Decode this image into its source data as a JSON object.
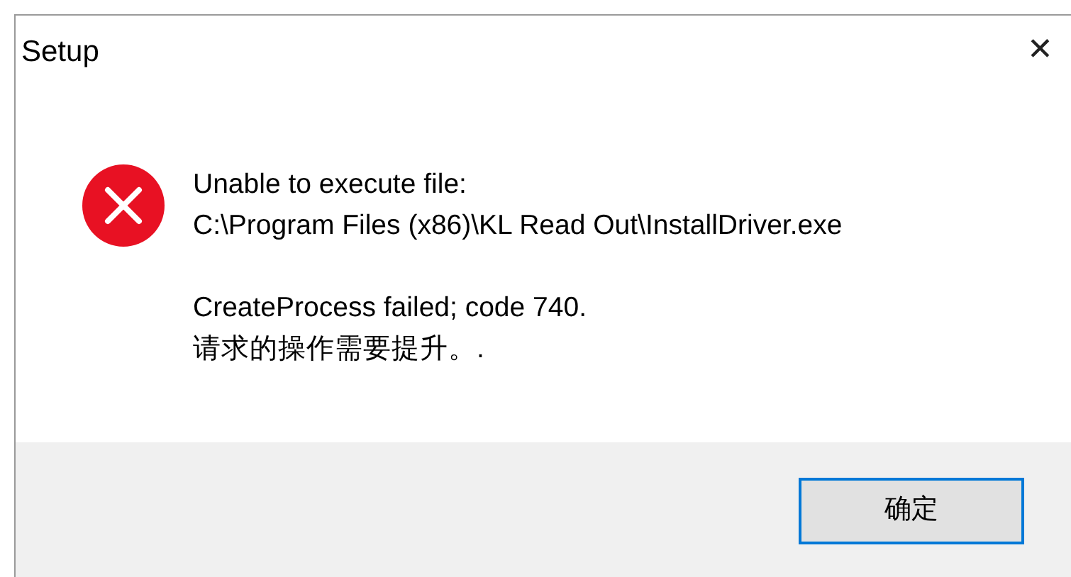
{
  "window": {
    "title": "Setup",
    "close": "✕"
  },
  "message": {
    "kind": "error",
    "paragraphs": [
      [
        "Unable to execute file:",
        "C:\\Program Files (x86)\\KL Read Out\\InstallDriver.exe"
      ],
      [
        "CreateProcess failed; code 740.",
        "请求的操作需要提升。."
      ]
    ]
  },
  "buttons": [
    {
      "label": "确定",
      "default": true
    }
  ]
}
